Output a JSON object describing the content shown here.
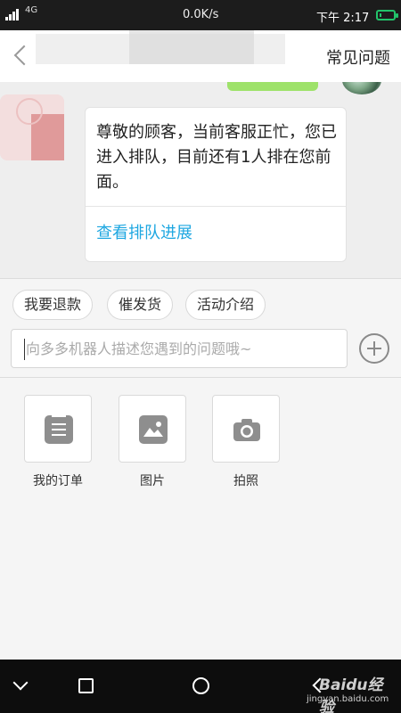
{
  "status_bar": {
    "network": "4G",
    "speed": "0.0K/s",
    "time": "下午 2:17"
  },
  "header": {
    "title": "常见问题"
  },
  "chat": {
    "message_text": "尊敬的顾客，当前客服正忙，您已进入排队，目前还有1人排在您前面。",
    "message_link": "查看排队进展"
  },
  "quick_replies": [
    "我要退款",
    "催发货",
    "活动介绍"
  ],
  "input": {
    "placeholder": "向多多机器人描述您遇到的问题哦~"
  },
  "tools": [
    {
      "label": "我的订单",
      "icon": "order-icon"
    },
    {
      "label": "图片",
      "icon": "image-icon"
    },
    {
      "label": "拍照",
      "icon": "camera-icon"
    }
  ],
  "watermark": {
    "logo": "Baidu经验",
    "site": "jingyan.baidu.com"
  },
  "colors": {
    "link": "#1ea7e1",
    "battery": "#22c36a",
    "sent_bubble": "#9ee26a"
  }
}
